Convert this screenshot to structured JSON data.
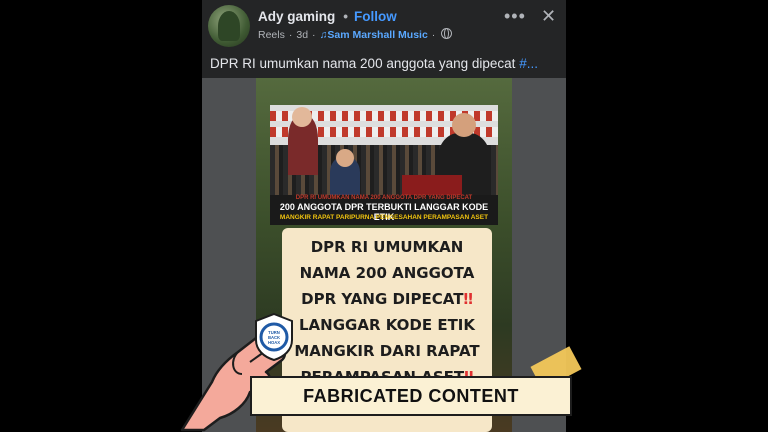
{
  "post": {
    "author": "Ady gaming",
    "separator": "•",
    "follow_label": "Follow",
    "source": "Reels",
    "age": "3d",
    "music": "Sam Marshall Music",
    "caption": "DPR RI umumkan nama 200 anggota yang dipecat ",
    "caption_hashtag": "#...",
    "icons": {
      "more": "more-options-icon",
      "close": "close-icon",
      "privacy": "globe-icon",
      "music": "music-note-icon"
    }
  },
  "video": {
    "band_small_top": "DPR RI UMUMKAN NAMA 200 ANGGOTA DPR YANG DIPECAT",
    "band_headline": "200 ANGGOTA DPR TERBUKTI LANGGAR KODE ETIK",
    "band_sub": "MANGKIR RAPAT PARIPURNA PENGESAHAN PERAMPASAN ASET",
    "lines": [
      "DPR RI UMUMKAN",
      "NAMA 200 ANGGOTA",
      "DPR YANG DIPECAT",
      "LANGGAR KODE ETIK",
      "MANGKIR DARI RAPAT",
      "PERAMPASAN ASET"
    ],
    "bang": "‼"
  },
  "label": {
    "verdict": "FABRICATED CONTENT",
    "badge_text": "TURN BACK HOAX",
    "badge_org": "MASYARAKAT ANTI FITNAH INDONESIA · MAFINDO",
    "colors": {
      "banner": "#fbf1d4",
      "tape": "#f3c85a",
      "hand": "#f4a99b",
      "accent": "#4599ff"
    }
  }
}
